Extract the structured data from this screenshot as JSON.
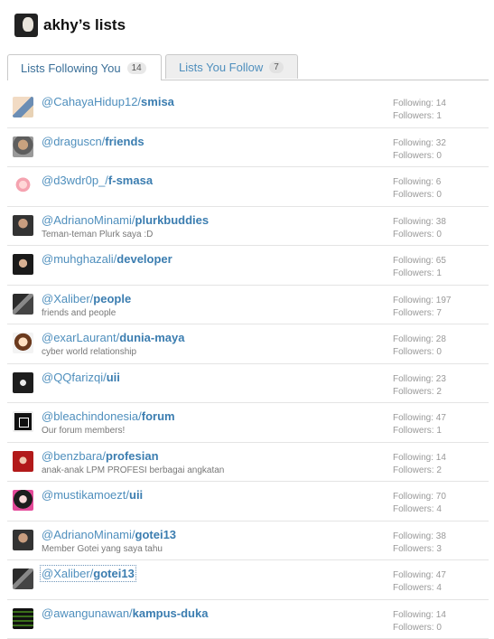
{
  "header": {
    "title": "akhy’s lists"
  },
  "tabs": [
    {
      "label": "Lists Following You",
      "count": "14"
    },
    {
      "label": "Lists You Follow",
      "count": "7"
    }
  ],
  "lists": [
    {
      "owner": "@CahayaHidup12/",
      "list": "smisa",
      "description": "",
      "following": "Following: 14",
      "followers": "Followers: 1"
    },
    {
      "owner": "@draguscn/",
      "list": "friends",
      "description": "",
      "following": "Following: 32",
      "followers": "Followers: 0"
    },
    {
      "owner": "@d3wdr0p_/",
      "list": "f-smasa",
      "description": "",
      "following": "Following: 6",
      "followers": "Followers: 0"
    },
    {
      "owner": "@AdrianoMinami/",
      "list": "plurkbuddies",
      "description": "Teman-teman Plurk saya :D",
      "following": "Following: 38",
      "followers": "Followers: 0"
    },
    {
      "owner": "@muhghazali/",
      "list": "developer",
      "description": "",
      "following": "Following: 65",
      "followers": "Followers: 1"
    },
    {
      "owner": "@Xaliber/",
      "list": "people",
      "description": "friends and people",
      "following": "Following: 197",
      "followers": "Followers: 7"
    },
    {
      "owner": "@exarLaurant/",
      "list": "dunia-maya",
      "description": "cyber world relationship",
      "following": "Following: 28",
      "followers": "Followers: 0"
    },
    {
      "owner": "@QQfarizqi/",
      "list": "uii",
      "description": "",
      "following": "Following: 23",
      "followers": "Followers: 2"
    },
    {
      "owner": "@bleachindonesia/",
      "list": "forum",
      "description": "Our forum members!",
      "following": "Following: 47",
      "followers": "Followers: 1"
    },
    {
      "owner": "@benzbara/",
      "list": "profesian",
      "description": "anak-anak LPM PROFESI berbagai angkatan",
      "following": "Following: 14",
      "followers": "Followers: 2"
    },
    {
      "owner": "@mustikamoezt/",
      "list": "uii",
      "description": "",
      "following": "Following: 70",
      "followers": "Followers: 4"
    },
    {
      "owner": "@AdrianoMinami/",
      "list": "gotei13",
      "description": "Member Gotei yang saya tahu",
      "following": "Following: 38",
      "followers": "Followers: 3"
    },
    {
      "owner": "@Xaliber/",
      "list": "gotei13",
      "description": "",
      "following": "Following: 47",
      "followers": "Followers: 4"
    },
    {
      "owner": "@awangunawan/",
      "list": "kampus-duka",
      "description": "",
      "following": "Following: 14",
      "followers": "Followers: 0"
    }
  ]
}
